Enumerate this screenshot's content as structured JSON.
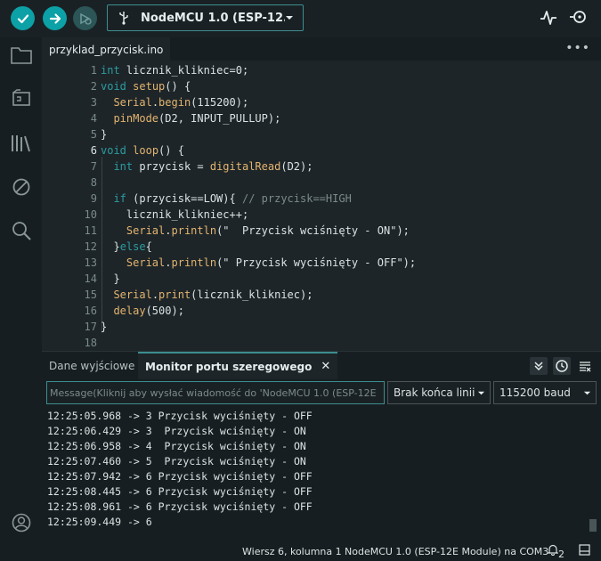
{
  "toolbar": {
    "verify_icon": "check-icon",
    "upload_icon": "arrow-right-icon",
    "debug_icon": "debug-icon",
    "board": "NodeMCU 1.0 (ESP-12...",
    "serial_plotter_icon": "pulse-icon",
    "serial_monitor_icon": "magnifier-icon",
    "accent_color": "#0ca1a6"
  },
  "activity": [
    "folder-icon",
    "board-icon",
    "library-icon",
    "debug-off-icon",
    "search-icon",
    "account-icon"
  ],
  "editor": {
    "file_tab": "przyklad_przycisk.ino",
    "more": "•••",
    "current_line": 6,
    "lines": [
      {
        "n": "1",
        "code": "int licznik_klikniec=0;"
      },
      {
        "n": "2",
        "code": "void setup() {"
      },
      {
        "n": "3",
        "code": "  Serial.begin(115200);"
      },
      {
        "n": "4",
        "code": "  pinMode(D2, INPUT_PULLUP);"
      },
      {
        "n": "5",
        "code": "}"
      },
      {
        "n": "6",
        "code": "void loop() {"
      },
      {
        "n": "7",
        "code": "  int przycisk = digitalRead(D2);"
      },
      {
        "n": "8",
        "code": ""
      },
      {
        "n": "9",
        "code": "  if (przycisk==LOW){ // przycisk==HIGH"
      },
      {
        "n": "10",
        "code": "    licznik_klikniec++;"
      },
      {
        "n": "11",
        "code": "    Serial.println(\"  Przycisk wciśnięty - ON\");"
      },
      {
        "n": "12",
        "code": "  }else{"
      },
      {
        "n": "13",
        "code": "    Serial.println(\" Przycisk wyciśnięty - OFF\");"
      },
      {
        "n": "14",
        "code": "  }"
      },
      {
        "n": "15",
        "code": "  Serial.print(licznik_klikniec);"
      },
      {
        "n": "16",
        "code": "  delay(500);"
      },
      {
        "n": "17",
        "code": "}"
      },
      {
        "n": "18",
        "code": ""
      }
    ]
  },
  "panel": {
    "tab_output": "Dane wyjściowe",
    "tab_monitor": "Monitor portu szeregowego",
    "close": "✕",
    "input_placeholder": "Message(Kliknij aby wysłać wiadomość do 'NodeMCU 1.0 (ESP-12E",
    "line_ending": "Brak końca linii",
    "baud": "115200 baud",
    "output_lines": [
      "12:25:05.968 -> 3 Przycisk wyciśnięty - OFF",
      "12:25:06.429 -> 3  Przycisk wciśnięty - ON",
      "12:25:06.958 -> 4  Przycisk wciśnięty - ON",
      "12:25:07.460 -> 5  Przycisk wciśnięty - ON",
      "12:25:07.942 -> 6 Przycisk wyciśnięty - OFF",
      "12:25:08.445 -> 6 Przycisk wyciśnięty - OFF",
      "12:25:08.961 -> 6 Przycisk wyciśnięty - OFF",
      "12:25:09.449 -> 6"
    ]
  },
  "status": {
    "cursor": "Wiersz 6, kolumna 1",
    "board_port": "NodeMCU 1.0 (ESP-12E Module) na COM3",
    "notifications": "2"
  }
}
